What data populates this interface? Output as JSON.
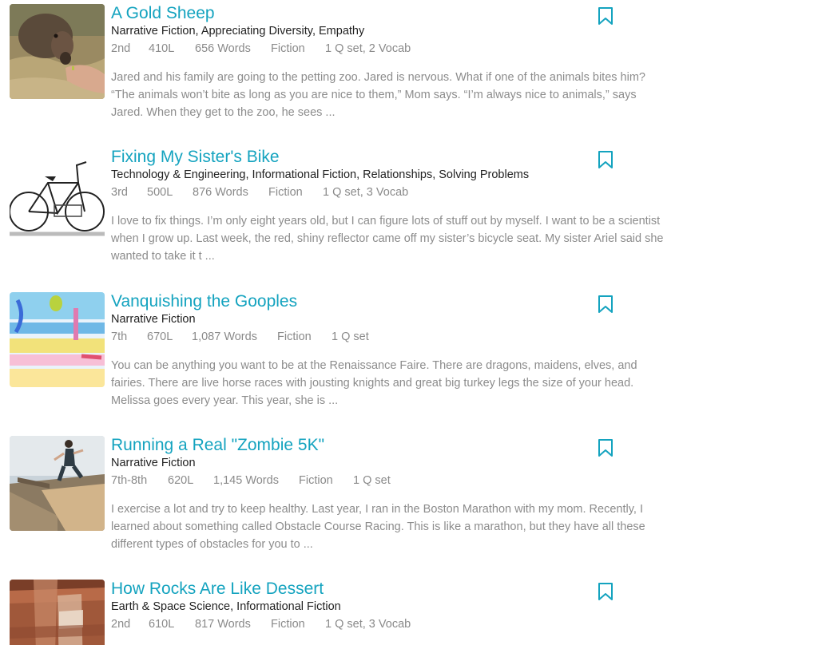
{
  "colors": {
    "title": "#14a3bf",
    "bookmark": "#14a3bf",
    "topics": "#222222",
    "meta": "#8a8a8a",
    "desc": "#8c8c8c"
  },
  "articles": [
    {
      "title": "A Gold Sheep",
      "topics": "Narrative Fiction, Appreciating Diversity, Empathy",
      "grade": "2nd",
      "lexile": "410L",
      "words": "656 Words",
      "genre": "Fiction",
      "assets": "1 Q set, 2 Vocab",
      "excerpt": "Jared and his family are going to the petting zoo. Jared is nervous. What if one of the animals bites him? “The animals won’t bite as long as you are nice to them,” Mom says. “I’m always nice to animals,” says Jared. When they get to the zoo, he sees ...",
      "thumb_icon": "goat-photo"
    },
    {
      "title": "Fixing My Sister's Bike",
      "topics": "Technology & Engineering, Informational Fiction, Relationships, Solving Problems",
      "grade": "3rd",
      "lexile": "500L",
      "words": "876 Words",
      "genre": "Fiction",
      "assets": "1 Q set, 3 Vocab",
      "excerpt": "I love to fix things. I’m only eight years old, but I can figure lots of stuff out by myself. I want to be a scientist when I grow up. Last week, the red, shiny reflector came off my sister’s bicycle seat. My sister Ariel said she wanted to take it t ...",
      "thumb_icon": "bicycle-illustration"
    },
    {
      "title": "Vanquishing the Gooples",
      "topics": "Narrative Fiction",
      "grade": "7th",
      "lexile": "670L",
      "words": "1,087 Words",
      "genre": "Fiction",
      "assets": "1 Q set",
      "excerpt": "You can be anything you want to be at the Renaissance Faire. There are dragons, maidens, elves, and fairies. There are live horse races with jousting knights and great big turkey legs the size of your head. Melissa goes every year. This year, she is ...",
      "thumb_icon": "watercolor-painting"
    },
    {
      "title": "Running a Real \"Zombie 5K\"",
      "topics": "Narrative Fiction",
      "grade": "7th-8th",
      "lexile": "620L",
      "words": "1,145 Words",
      "genre": "Fiction",
      "assets": "1 Q set",
      "excerpt": "I exercise a lot and try to keep healthy. Last year, I ran in the Boston Marathon with my mom. Recently, I learned about something called Obstacle Course Racing. This is like a marathon, but they have all these different types of obstacles for you to ...",
      "thumb_icon": "obstacle-race-photo"
    },
    {
      "title": "How Rocks Are Like Dessert",
      "topics": "Earth & Space Science, Informational Fiction",
      "grade": "2nd",
      "lexile": "610L",
      "words": "817 Words",
      "genre": "Fiction",
      "assets": "1 Q set, 3 Vocab",
      "excerpt": "",
      "thumb_icon": "rock-layers-photo"
    }
  ]
}
